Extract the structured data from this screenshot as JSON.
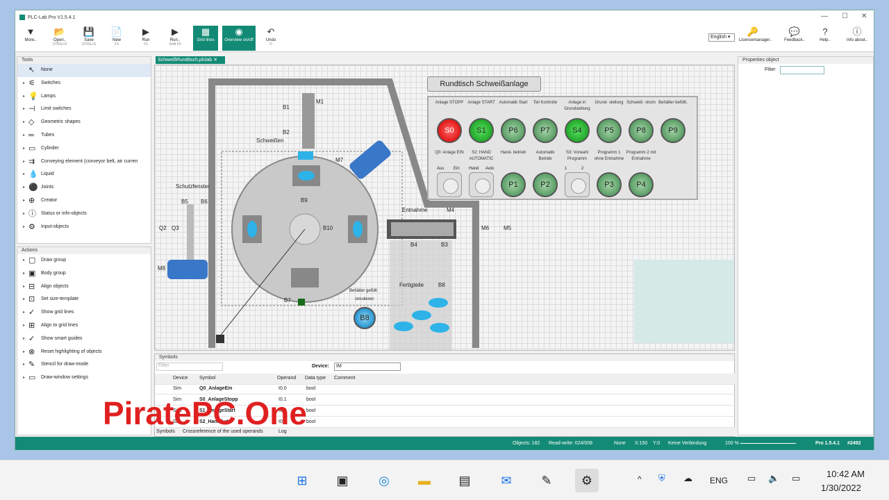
{
  "app": {
    "title": "PLC-Lab Pro V1.5.4.1"
  },
  "toolbar": [
    {
      "label": "More..",
      "sc": "",
      "icon": "▼"
    },
    {
      "label": "Open..",
      "sc": "STRG+O",
      "icon": "📂"
    },
    {
      "label": "Save",
      "sc": "STRG+S",
      "icon": "💾"
    },
    {
      "label": "New",
      "sc": "F4",
      "icon": "📄"
    },
    {
      "label": "Run",
      "sc": "F5",
      "icon": "▶"
    },
    {
      "label": "Run..",
      "sc": "Shift F5",
      "icon": "▶"
    },
    {
      "label": "Grid lines",
      "sc": "",
      "icon": "▦"
    },
    {
      "label": "Overview on/off",
      "sc": "",
      "icon": "◉"
    },
    {
      "label": "Undo",
      "sc": "D",
      "icon": "↶"
    }
  ],
  "right_toolbar": {
    "language": "English",
    "license": "Licensemanager..",
    "feedback": "Feedback..",
    "help": "Help..",
    "info": "Info about.."
  },
  "tools": {
    "title": "Tools",
    "items": [
      "None",
      "Switches",
      "Lamps",
      "Limit switches",
      "Geometric shapes",
      "Tubes",
      "Cylinder",
      "Conveying element (conveyor belt, air curren",
      "Liquid",
      "Joints",
      "Creator",
      "Status or info-objects",
      "Input-objects"
    ]
  },
  "actions": {
    "title": "Actions",
    "items": [
      "Draw group",
      "Body group",
      "Align objects",
      "Set size-template",
      "Show grid lines",
      "Align to grid lines",
      "Show smart guides",
      "Reset highlighting of objects",
      "Stencil for draw-mode",
      "Draw-window settings"
    ]
  },
  "doc_tab": "SchweißRundtisch.plclab",
  "scene": {
    "panel_title": "Rundtisch Schweißanlage",
    "row1_labels": [
      "Anlage STOPP",
      "Anlage START",
      "Automatik Start",
      "Teil Kontrolle",
      "Anlage in Grundstellung",
      "Grund- stellung",
      "Schweiß- strom",
      "Behälter befüllt."
    ],
    "row1_buttons": [
      "S0",
      "S1",
      "P6",
      "P7",
      "S4",
      "P5",
      "P8",
      "P9"
    ],
    "row2_labels": [
      "Q0: Anlage EIN",
      "S2: HAND AUTOMATIC",
      "Hand- betrieb",
      "Automatik Betrieb",
      "S3: Vorwahl Programm",
      "Programm 1 ohne Entnahme",
      "Programm 2 mit Entnahme"
    ],
    "row2_buttons": [
      "P1",
      "P2",
      "P3",
      "P4"
    ],
    "sw1_left": "Aus",
    "sw1_right": "Ein",
    "sw2_left": "Hand",
    "sw2_right": "Auto",
    "sw3_left": "1",
    "sw3_right": "2",
    "labels": {
      "b1": "B1",
      "m1": "M1",
      "b2": "B2",
      "schweissen": "Schweißen",
      "m7": "M7",
      "schutzfenster": "Schutzfenster",
      "b5": "B5",
      "b6": "B6",
      "q2": "Q2",
      "q3": "Q3",
      "b9": "B9",
      "b10": "B10",
      "entnahme": "Entnahme",
      "m4": "M4",
      "m6": "M6",
      "m5": "M5",
      "b4": "B4",
      "b3": "B3",
      "m8": "M8",
      "b7": "B7",
      "behaelter": "Behälter gefüllt",
      "simulieren": "simulieren",
      "b8btn": "B8",
      "fertigteile": "Fertigteile",
      "b8": "B8"
    }
  },
  "properties": {
    "title": "Properties object",
    "filter_label": "Filter"
  },
  "symbols": {
    "title": "Symbols",
    "filter_ph": "Filter",
    "device_label": "Device:",
    "device_val": "IM",
    "headers": [
      "Device",
      "Symbol",
      "Operand",
      "Data type",
      "Comment"
    ],
    "rows": [
      {
        "device": "Sim",
        "symbol": "Q0_AnlageEin",
        "operand": "I0.0",
        "dtype": "bool"
      },
      {
        "device": "Sim",
        "symbol": "S0_AnlageStopp",
        "operand": "I0.1",
        "dtype": "bool"
      },
      {
        "device": "Sim",
        "symbol": "S1_AnlageStart",
        "operand": "I0.2",
        "dtype": "bool"
      },
      {
        "device": "Sim",
        "symbol": "S2_HandAuto",
        "operand": "I0.3",
        "dtype": "bool"
      }
    ],
    "tabs": [
      "Symbols",
      "Crossreference of the used operands",
      "Log"
    ]
  },
  "status": {
    "objects": "Objects: 182",
    "rw": "Read-write: 024/008",
    "none": "None",
    "x": "X:150",
    "y": "Y:0",
    "conn": "Keine Verbindung",
    "zoom": "100 %",
    "version": "Pro 1.5.4.1",
    "build": "#2492"
  },
  "watermark": "PiratePC.One",
  "taskbar": {
    "lang": "ENG",
    "time": "10:42 AM",
    "date": "1/30/2022"
  }
}
